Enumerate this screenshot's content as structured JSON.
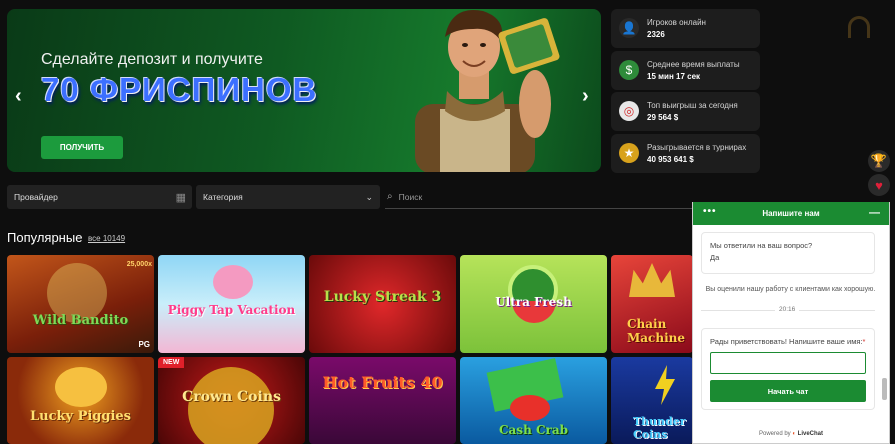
{
  "banner": {
    "subtitle": "Сделайте депозит и получите",
    "headline": "70 ФРИСПИНОВ",
    "cta": "ПОЛУЧИТЬ",
    "prev": "‹",
    "next": "›"
  },
  "stats": [
    {
      "label": "Игроков онлайн",
      "value": "2326",
      "icon": "user-icon",
      "color": "#2a2a2a"
    },
    {
      "label": "Среднее время выплаты",
      "value": "15 мин 17 сек",
      "icon": "money-bag-icon",
      "color": "#2e8b3a"
    },
    {
      "label": "Топ выигрыш за сегодня",
      "value": "29 564 $",
      "icon": "target-icon",
      "color": "#e8e8e8"
    },
    {
      "label": "Разыгрывается в турнирах",
      "value": "40 953 641 $",
      "icon": "medal-icon",
      "color": "#d8a21c"
    }
  ],
  "filters": {
    "provider": "Провайдер",
    "category": "Категория",
    "search_placeholder": "Поиск"
  },
  "section": {
    "title": "Популярные",
    "all": "все 10149"
  },
  "games_row1": [
    {
      "name": "Wild Bandito",
      "badge": "PG",
      "extra": "25,000x"
    },
    {
      "name": "Piggy Tap Vacation"
    },
    {
      "name": "Lucky Streak 3"
    },
    {
      "name": "Ultra Fresh"
    },
    {
      "name": "Chain Machine"
    }
  ],
  "games_row2": [
    {
      "name": "Lucky Piggies"
    },
    {
      "name": "Crown Coins",
      "badge": "NEW"
    },
    {
      "name": "Hot Fruits 40"
    },
    {
      "name": "Cash Crab"
    },
    {
      "name": "Thunder Coins"
    }
  ],
  "chat": {
    "header": "Напишите нам",
    "question": "Мы ответили на ваш вопрос?",
    "answer": "Да",
    "rated": "Вы оценили нашу работу с клиентами как хорошую.",
    "time": "20:16",
    "prompt": "Рады приветствовать! Напишите ваше имя:",
    "required": "*",
    "start": "Начать чат",
    "powered": "Powered by",
    "brand": "LiveChat"
  },
  "colors": {
    "accent": "#1c9b3d",
    "chat_header": "#1b8b32"
  }
}
